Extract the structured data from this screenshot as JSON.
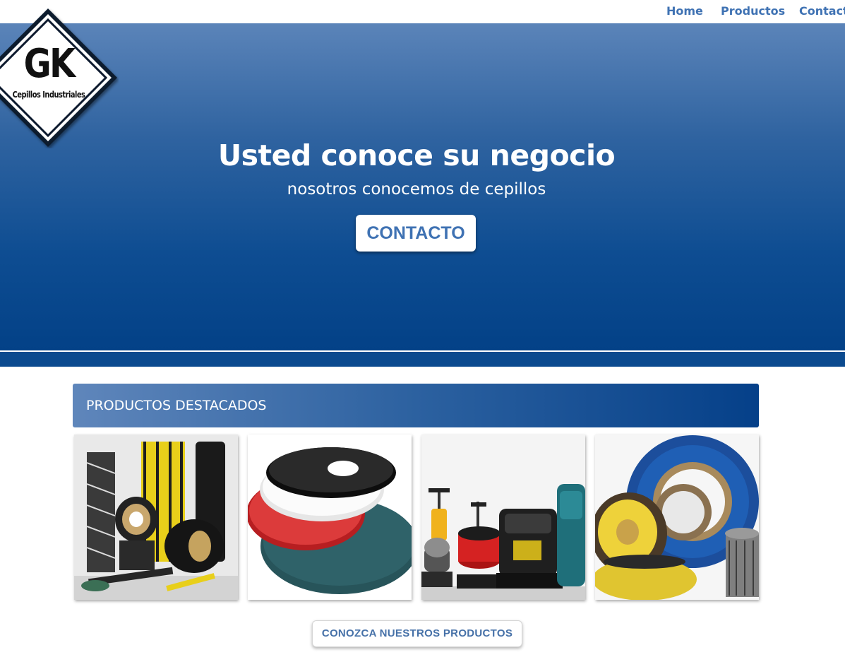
{
  "nav": {
    "items": [
      {
        "label": "Home"
      },
      {
        "label": "Productos"
      },
      {
        "label": "Contacto"
      }
    ]
  },
  "logo": {
    "initials": "GK",
    "tagline": "Cepillos Industriales"
  },
  "hero": {
    "title": "Usted conoce su negocio",
    "subtitle": "nosotros conocemos de cepillos",
    "cta_label": "CONTACTO"
  },
  "featured": {
    "title": "PRODUCTOS DESTACADOS",
    "products": [
      {
        "image": "industrial-brush-assortment-photo"
      },
      {
        "image": "floor-pads-photo"
      },
      {
        "image": "floor-cleaning-machines-photo"
      },
      {
        "image": "circular-wire-brushes-photo"
      }
    ],
    "button_label": "CONOZCA NUESTROS PRODUCTOS"
  },
  "colors": {
    "accent": "#3f72b3",
    "hero_dark": "#034187",
    "hero_light": "#5b84b9"
  }
}
